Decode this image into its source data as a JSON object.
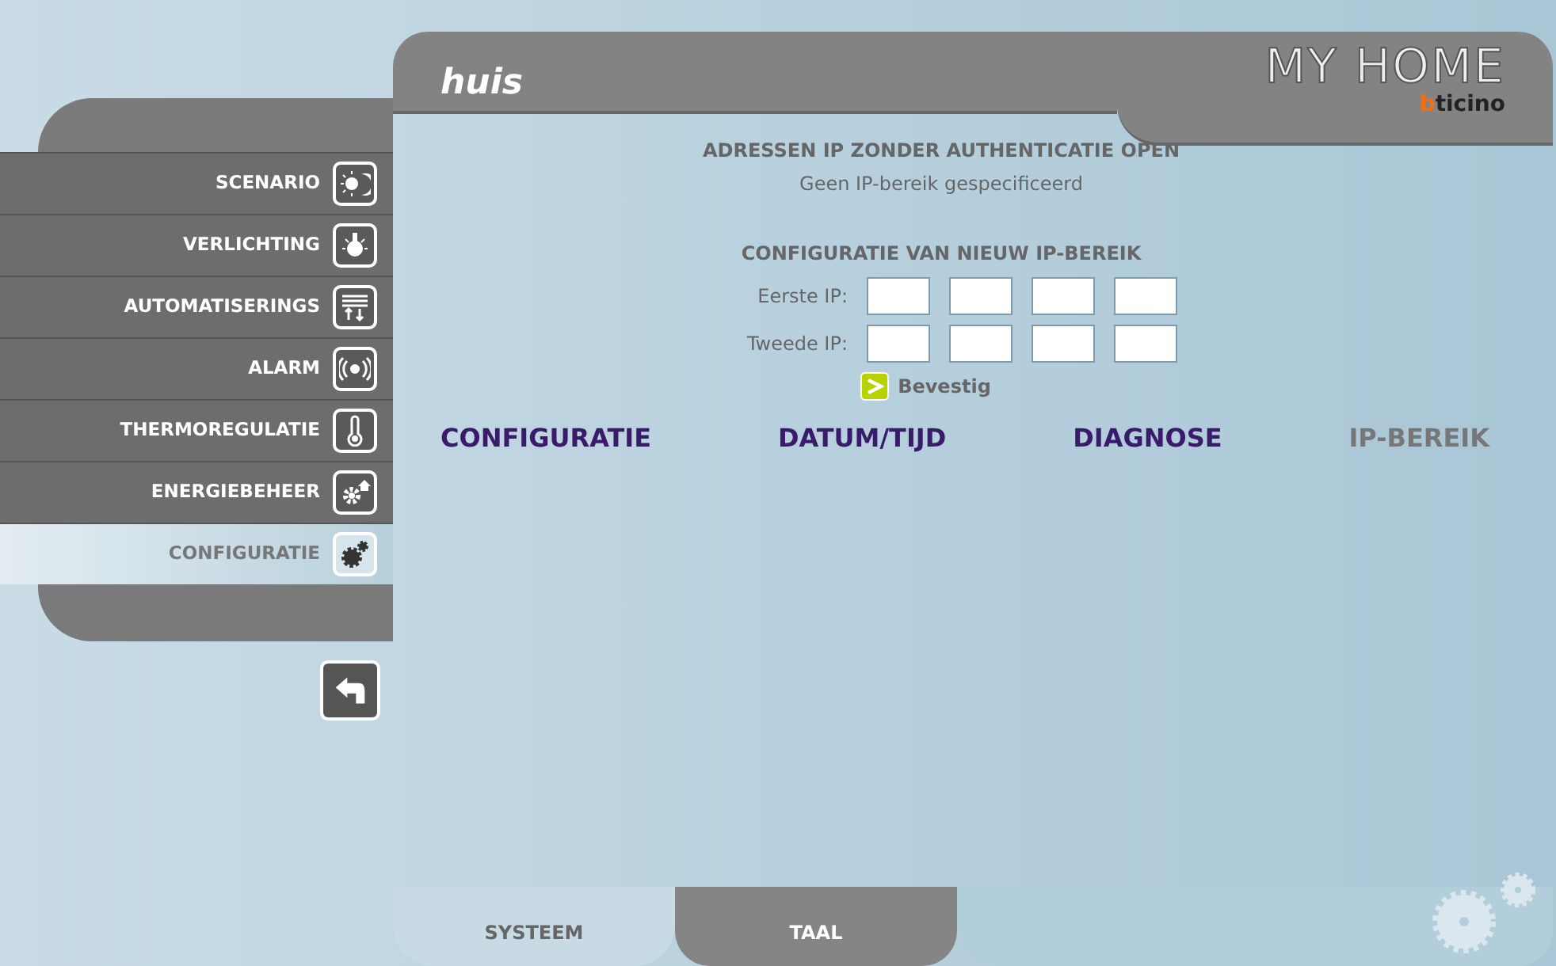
{
  "header": {
    "title": "huis",
    "product": "MY HOME",
    "brand": "bticino"
  },
  "sidebar": {
    "items": [
      {
        "label": "SCENARIO",
        "kind": "scenario",
        "selected": false
      },
      {
        "label": "VERLICHTING",
        "kind": "light",
        "selected": false
      },
      {
        "label": "AUTOMATISERINGS",
        "kind": "blinds",
        "selected": false
      },
      {
        "label": "ALARM",
        "kind": "alarm",
        "selected": false
      },
      {
        "label": "THERMOREGULATIE",
        "kind": "thermo",
        "selected": false
      },
      {
        "label": "ENERGIEBEHEER",
        "kind": "energy",
        "selected": false
      },
      {
        "label": "CONFIGURATIE",
        "kind": "gears",
        "selected": true
      }
    ]
  },
  "section": {
    "title": "ADRESSEN IP ZONDER AUTHENTICATIE OPEN",
    "message": "Geen IP-bereik gespecificeerd"
  },
  "form": {
    "title": "CONFIGURATIE VAN NIEUW IP-BEREIK",
    "rows": [
      {
        "label": "Eerste IP:"
      },
      {
        "label": "Tweede IP:"
      }
    ],
    "submit": "Bevestig"
  },
  "tabs": [
    {
      "label": "CONFIGURATIE",
      "selected": false
    },
    {
      "label": "DATUM/TIJD",
      "selected": false
    },
    {
      "label": "DIAGNOSE",
      "selected": false
    },
    {
      "label": "IP-BEREIK",
      "selected": true
    }
  ],
  "bottom_tabs": [
    {
      "label": "SYSTEEM",
      "selected": true
    },
    {
      "label": "TAAL",
      "selected": false
    }
  ]
}
